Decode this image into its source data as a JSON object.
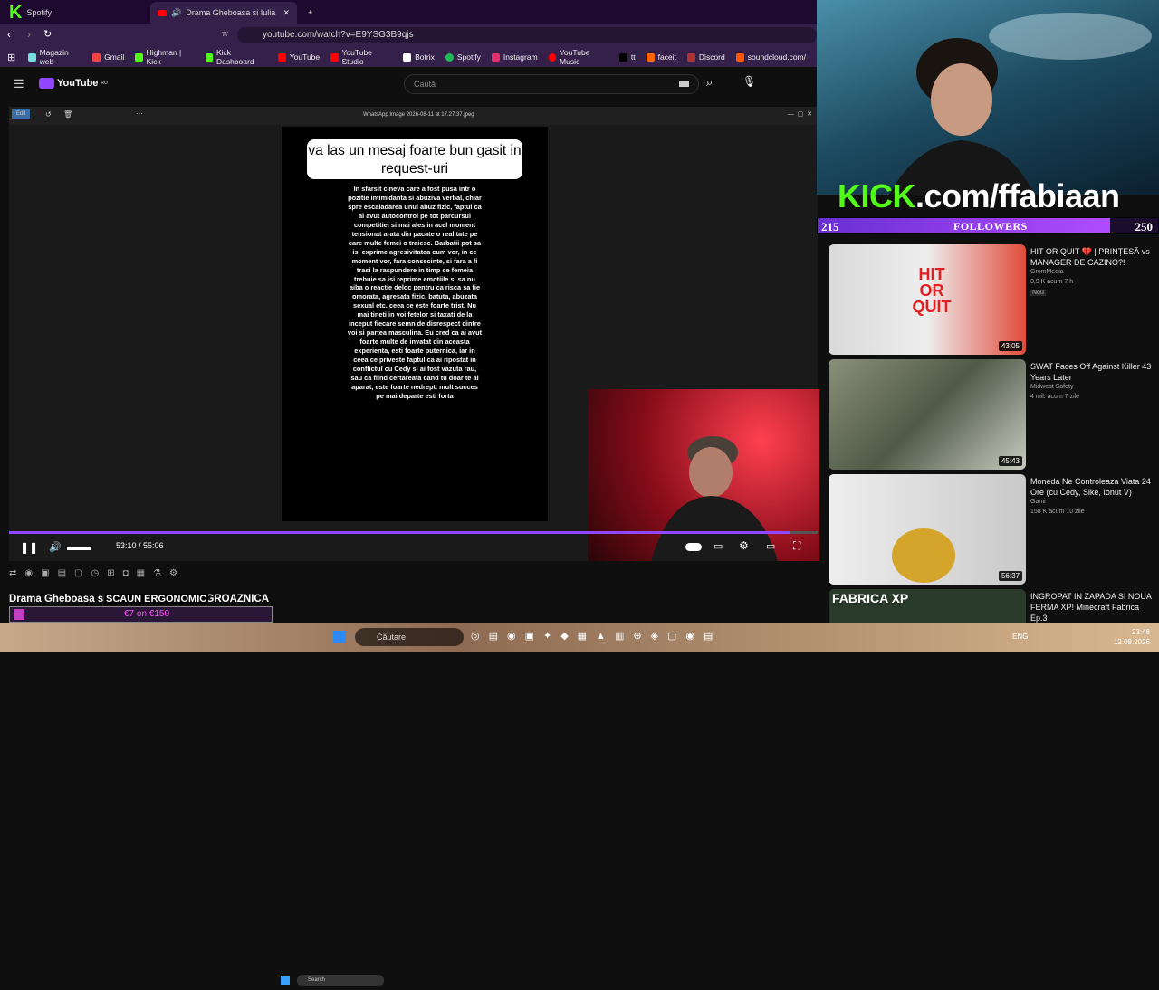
{
  "browser": {
    "tab_prev": "Spotify",
    "tab_active": "Drama Gheboasa si Iulia SCS",
    "new_tab": "+",
    "url": "youtube.com/watch?v=E9YSG3B9qjs",
    "bookmarks": [
      "Magazin web",
      "Gmail",
      "Highman | Kick",
      "Kick Dashboard",
      "YouTube",
      "YouTube Studio",
      "Botrix",
      "Spotify",
      "Instagram",
      "YouTube Music",
      "tt",
      "faceit",
      "Discord",
      "soundcloud.com/"
    ]
  },
  "youtube": {
    "logo": "YouTube",
    "region": "RO",
    "search_placeholder": "Caută"
  },
  "viewer": {
    "filename": "WhatsApp Image 2026-08-11 at 17.27.37.jpeg",
    "edit": "Edit",
    "bubble": "va las un mesaj foarte bun gasit in request-uri",
    "body": "In sfarsit cineva care a fost pusa intr o pozitie intimidanta si abuziva verbal, chiar spre escaladarea unui abuz fizic, faptul ca ai avut autocontrol pe tot parcursul competitiei si mai ales in acel moment tensionat arata din pacate o realitate pe care multe femei o traiesc. Barbatii pot sa isi exprime agresivitatea cum vor, in ce moment vor, fara consecinte, si fara a fi trasi la raspundere in timp ce femeia trebuie sa isi reprime emotiile si sa nu aiba o reactie deloc pentru ca risca sa fie omorata, agresata fizic, batuta, abuzata sexual etc. ceea ce este foarte trist. Nu mai tineti in voi fetelor si taxati de la inceput fiecare semn de disrespect dintre voi si partea masculina. Eu cred ca ai avut foarte multe de invatat din aceasta experienta, esti foarte puternica, iar in ceea ce priveste faptul ca ai ripostat in conflictul cu Cedy si ai fost vazuta rau, sau ca fiind certareata cand tu doar te ai aparat, este foarte nedrept. mult succes pe mai departe esti forta"
  },
  "player": {
    "time": "53:10 / 55:06",
    "progress": 0.965,
    "inner_search": "Search"
  },
  "video": {
    "title": "Drama Gheboasa si",
    "title_tail": "GROAZNICA",
    "overlay_text": "SCAUN ERGONOMIC",
    "promo": "€7 on €150"
  },
  "stream": {
    "kick_prefix": "KICK",
    "kick_suffix": ".com/ffabiaan",
    "followers_label": "FOLLOWERS",
    "followers_current": "215",
    "followers_goal": "250",
    "progress": 0.86
  },
  "recommendations": [
    {
      "title": "HIT OR QUIT 💔 | PRINȚESĂ vs MANAGER DE CAZINO?!",
      "channel": "GromMedia",
      "meta": "3,9 K  acum 7 h",
      "badge": "Nou",
      "duration": "43:05",
      "thumb_text": "HIT OR QUIT"
    },
    {
      "title": "SWAT Faces Off Against Killer 43 Years Later",
      "channel": "Midwest Safety",
      "meta": "4 mil.  acum 7 zile",
      "duration": "45:43"
    },
    {
      "title": "Moneda Ne Controleaza Viata 24 Ore (cu Cedy, Sike, Ionut V)",
      "channel": "Gami",
      "meta": "158 K  acum 10 zile",
      "duration": "56:37"
    },
    {
      "title": "INGROPAT IN ZAPADA SI NOUA FERMA XP! Minecraft Fabrica Ep.3",
      "channel": "",
      "meta": "",
      "duration": "",
      "thumb_text": "FABRICA XP"
    }
  ],
  "taskbar": {
    "search": "Căutare",
    "lang": "ENG",
    "time": "23:48",
    "date": "12.08.2026"
  },
  "colors": {
    "kick_green": "#53fc18",
    "follower_bar": "#9147ff",
    "youtube_red": "#ff0000"
  }
}
